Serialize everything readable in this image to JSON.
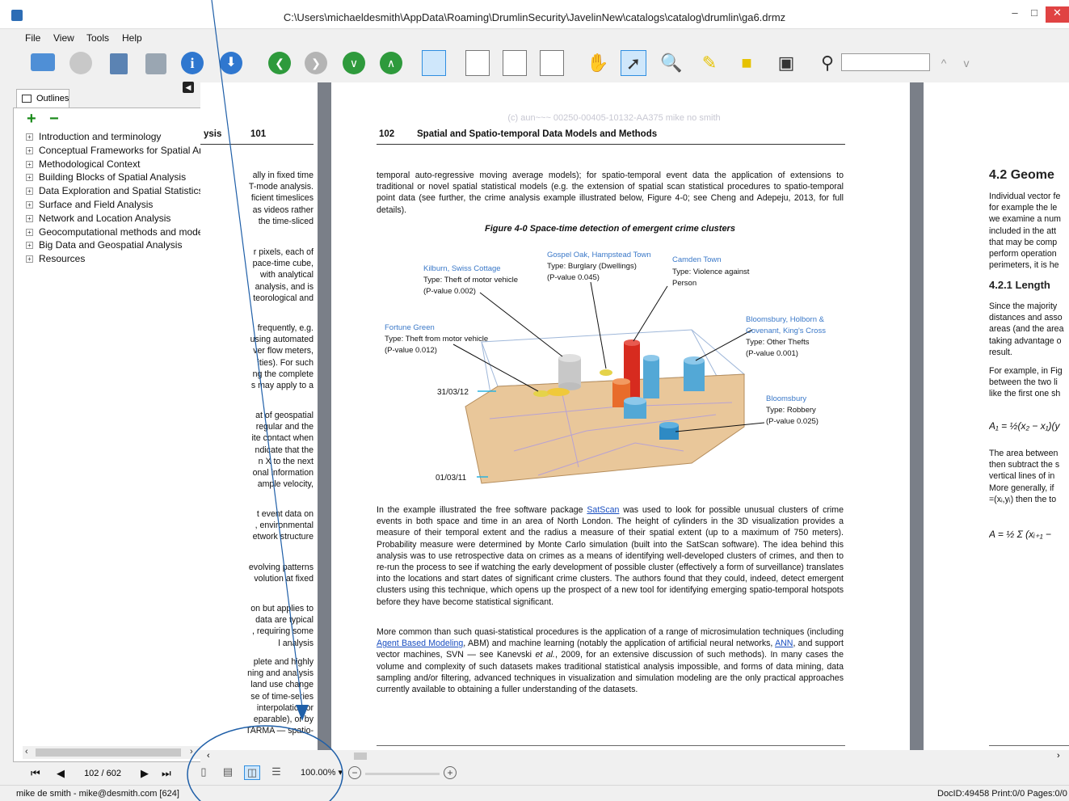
{
  "window": {
    "title": "C:\\Users\\michaeldesmith\\AppData\\Roaming\\DrumlinSecurity\\JavelinNew\\catalogs\\catalog\\drumlin\\ga6.drmz",
    "minimize": "–",
    "maximize": "□",
    "close": "✕"
  },
  "menu": [
    "File",
    "View",
    "Tools",
    "Help"
  ],
  "toolbar": {
    "icons": [
      "folder-icon",
      "bell-icon",
      "document-icon",
      "save-icon",
      "info-icon",
      "download-icon",
      "first-page-icon",
      "previous-icon",
      "next-icon",
      "last-page-icon",
      "page-layout-icons",
      "hand-icon",
      "pointer-icon",
      "zoom-region-icon",
      "highlighter-icon",
      "note-icon",
      "presentation-icon",
      "search-icon"
    ],
    "info_glyph": "i",
    "search_value": "",
    "search_up": "^",
    "search_down": "v",
    "accent": "#2f8ee0"
  },
  "outlines": {
    "tab_label": "Outlines",
    "expand_all": "+",
    "collapse_all": "−",
    "items": [
      "Introduction and terminology",
      "Conceptual Frameworks for Spatial Analysis",
      "Methodological Context",
      "Building Blocks of Spatial Analysis",
      "Data Exploration and Spatial Statistics",
      "Surface and Field Analysis",
      "Network and Location Analysis",
      "Geocomputational methods and modelling",
      "Big Data and Geospatial Analysis",
      "Resources"
    ]
  },
  "left_page": {
    "header_fragment": "ysis",
    "page_number": "101",
    "blocks": [
      [
        "ally in fixed time",
        "T-mode analysis.",
        "ficient timeslices",
        "as videos rather",
        "the time-sliced"
      ],
      [
        "r pixels, each of",
        "pace-time cube,",
        "with analytical",
        "analysis, and is",
        "teorological and"
      ],
      [
        "frequently, e.g.",
        "using automated",
        "ver flow meters,",
        "ities). For such",
        "ng the complete",
        "s may apply to a"
      ],
      [
        "at of geospatial",
        "regular and the",
        "ite contact when",
        "ndicate that the",
        "n X to the next",
        "onal information",
        "ample velocity,"
      ],
      [
        "t event data on",
        ", environmental",
        "etwork structure"
      ],
      [
        "evolving patterns",
        "volution at fixed"
      ],
      [
        "on but applies to",
        "data are typical",
        ", requiring some",
        "l analysis"
      ],
      [
        "plete and highly",
        "ning and analysis",
        "land use change",
        "se of time-series",
        "interpolation or",
        "eparable), or by",
        "TARMA — spatio-"
      ]
    ]
  },
  "main_page": {
    "watermark": "(c) aun~~~ 00250-00405-10132-AA375 mike no smith",
    "page_number": "102",
    "running_title": "Spatial and Spatio-temporal Data Models and Methods",
    "para1": "temporal auto-regressive moving average models); for spatio-temporal event data the application of extensions to traditional or novel spatial statistical models (e.g. the extension of spatial scan statistical procedures to spatio-temporal point data (see further, the crime analysis example illustrated below, Figure 4-0; see Cheng and Adepeju, 2013, for full details).",
    "figure_caption": "Figure 4-0 Space-time detection of emergent crime clusters",
    "figure": {
      "date_top": "31/03/12",
      "date_bottom": "01/03/11",
      "callouts": [
        {
          "place": "Kilburn, Swiss Cottage",
          "type": "Type: Theft of motor vehicle",
          "p": "(P-value 0.002)"
        },
        {
          "place": "Gospel Oak, Hampstead Town",
          "type": "Type: Burglary (Dwellings)",
          "p": "(P-value 0.045)"
        },
        {
          "place": "Camden Town",
          "type": "Type: Violence against",
          "p": "Person"
        },
        {
          "place": "Fortune Green",
          "type": "Type: Theft from motor vehicle",
          "p": "(P-value 0.012)"
        },
        {
          "place": "Bloomsbury, Holborn &",
          "place2": "Covenant, King's Cross",
          "type": "Type: Other Thefts",
          "p": "(P-value 0.001)"
        },
        {
          "place": "Bloomsbury",
          "type": "Type: Robbery",
          "p": "(P-value 0.025)"
        }
      ]
    },
    "para2_pre": "In the example illustrated the free software package ",
    "para2_link": "SatScan",
    "para2_post": " was used to look for possible unusual clusters of crime events in both space and time in an area of North London. The height of cylinders in the 3D visualization provides a measure of their temporal extent and the radius a measure of their spatial extent (up to a maximum of 750 meters). Probability measure were determined by Monte Carlo simulation (built into the SatScan software). The idea behind this analysis was to use retrospective data on crimes as a means of identifying well-developed clusters of crimes, and then to re-run the process to see if watching the early development of possible cluster (effectively a form of surveillance) translates into the locations and start dates of significant crime clusters. The authors found that they could, indeed, detect emergent clusters using this technique, which opens up the prospect of a new tool for identifying emerging spatio-temporal hotspots before they have become statistical significant.",
    "para3_pre": "More common than such quasi-statistical procedures is the application of a range of microsimulation techniques (including ",
    "para3_link1": "Agent Based Modeling",
    "para3_mid1": ", ABM) and machine learning (notably the application of artificial neural networks, ",
    "para3_link2": "ANN",
    "para3_mid2": ", and support vector machines, SVN — see Kanevski ",
    "para3_etal": "et al.",
    "para3_post": ", 2009, for an extensive discussion of such methods). In many cases the volume and complexity of such datasets makes traditional statistical analysis impossible, and forms of data mining, data sampling and/or filtering, advanced techniques in visualization and simulation modeling are the only practical approaches currently available to obtaining a fuller understanding of the datasets."
  },
  "right_page": {
    "heading": "4.2  Geome",
    "lines1": [
      "Individual vector fe",
      "for example the le",
      "we examine a num",
      "included in the att",
      "that may be comp",
      "perform operation",
      "perimeters, it is he"
    ],
    "subheading": "4.2.1  Length",
    "lines2": [
      "Since the majority",
      "distances and asso",
      "areas (and the area",
      "taking advantage o",
      "result."
    ],
    "lines3": [
      "For example, in Fig",
      "between the two li",
      "like the first one sh"
    ],
    "formula1": "A₁ = ½(x₂ − x₁)(y",
    "lines4": [
      "The area between",
      "then subtract the s",
      "vertical lines of in",
      "More generally, if",
      "=(xᵢ,yᵢ) then the to"
    ],
    "formula2": "A = ½ Σ (xᵢ₊₁ −"
  },
  "bottom": {
    "first": "⏮",
    "prev": "◀",
    "page_indicator": "102 / 602",
    "next": "▶",
    "last": "⏭",
    "zoom": "100.00%",
    "zoom_caret": "▾",
    "zoom_out": "−",
    "zoom_in": "+"
  },
  "status": {
    "user": "mike de smith - mike@desmith.com [624]",
    "doc_info": "DocID:49458 Print:0/0 Pages:0/0"
  }
}
